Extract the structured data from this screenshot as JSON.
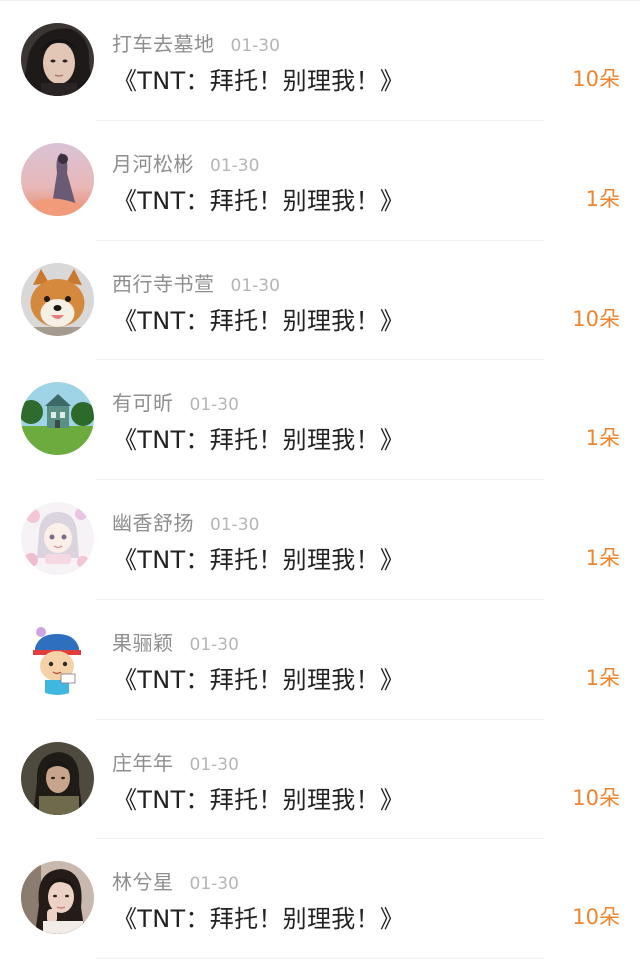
{
  "colors": {
    "name": "#8e8e8e",
    "date": "#b5b5b5",
    "title": "#222222",
    "count": "#f0842f",
    "divider": "#f1f1f1"
  },
  "items": [
    {
      "name": "打车去墓地",
      "date": "01-30",
      "title": "《TNT：拜托！别理我！》",
      "count": "10朵",
      "avatar": "avatar-man-dark-hair"
    },
    {
      "name": "月河松彬",
      "date": "01-30",
      "title": "《TNT：拜托！别理我！》",
      "count": "1朵",
      "avatar": "avatar-pink-sky-figure"
    },
    {
      "name": "西行寺书萱",
      "date": "01-30",
      "title": "《TNT：拜托！别理我！》",
      "count": "10朵",
      "avatar": "avatar-shiba-dog"
    },
    {
      "name": "有可昕",
      "date": "01-30",
      "title": "《TNT：拜托！别理我！》",
      "count": "1朵",
      "avatar": "avatar-green-house"
    },
    {
      "name": "幽香舒扬",
      "date": "01-30",
      "title": "《TNT：拜托！别理我！》",
      "count": "1朵",
      "avatar": "avatar-anime-flowers"
    },
    {
      "name": "果骊颖",
      "date": "01-30",
      "title": "《TNT：拜托！别理我！》",
      "count": "1朵",
      "avatar": "avatar-cartoon-boy"
    },
    {
      "name": "庄年年",
      "date": "01-30",
      "title": "《TNT：拜托！别理我！》",
      "count": "10朵",
      "avatar": "avatar-girl-dark"
    },
    {
      "name": "林兮星",
      "date": "01-30",
      "title": "《TNT：拜托！别理我！》",
      "count": "10朵",
      "avatar": "avatar-girl-portrait"
    }
  ]
}
